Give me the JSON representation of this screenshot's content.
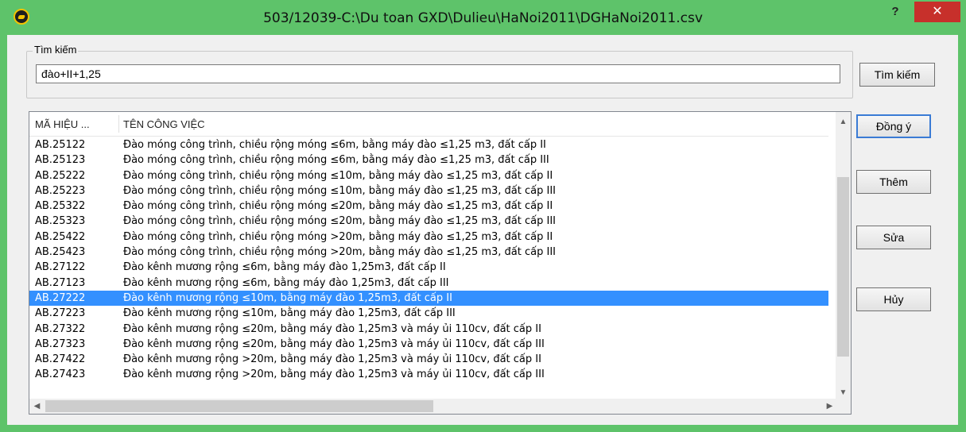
{
  "window": {
    "title": "503/12039-C:\\Du toan GXD\\Dulieu\\HaNoi2011\\DGHaNoi2011.csv",
    "help_label": "?",
    "close_label": "✕",
    "colors": {
      "titlebar": "#5ec36a",
      "close": "#c7302b",
      "selection": "#3390ff"
    }
  },
  "search": {
    "group_label": "Tìm kiếm",
    "value": "đào+II+1,25",
    "button_label": "Tìm kiếm"
  },
  "list": {
    "columns": [
      "MÃ HIỆU ...",
      "TÊN CÔNG VIỆC"
    ],
    "selected_index": 10,
    "rows": [
      {
        "code": "AB.25122",
        "name": "Đào móng công trình, chiều rộng móng ≤6m, bằng máy đào ≤1,25 m3, đất cấp II"
      },
      {
        "code": "AB.25123",
        "name": "Đào móng công trình, chiều rộng móng ≤6m, bằng máy đào ≤1,25 m3, đất cấp III"
      },
      {
        "code": "AB.25222",
        "name": "Đào móng công trình, chiều rộng móng ≤10m, bằng máy đào ≤1,25 m3, đất cấp II"
      },
      {
        "code": "AB.25223",
        "name": "Đào móng công trình, chiều rộng móng ≤10m, bằng máy đào ≤1,25 m3, đất cấp III"
      },
      {
        "code": "AB.25322",
        "name": "Đào móng công trình, chiều rộng móng ≤20m, bằng máy đào ≤1,25 m3, đất cấp II"
      },
      {
        "code": "AB.25323",
        "name": "Đào móng công trình, chiều rộng móng ≤20m, bằng máy đào ≤1,25 m3, đất cấp III"
      },
      {
        "code": "AB.25422",
        "name": "Đào móng công trình, chiều rộng móng >20m, bằng máy đào ≤1,25 m3, đất cấp II"
      },
      {
        "code": "AB.25423",
        "name": "Đào móng công trình, chiều rộng móng >20m, bằng máy đào ≤1,25 m3, đất cấp III"
      },
      {
        "code": "AB.27122",
        "name": "Đào kênh mương rộng ≤6m, bằng máy đào 1,25m3, đất cấp II"
      },
      {
        "code": "AB.27123",
        "name": "Đào kênh mương rộng ≤6m, bằng máy đào 1,25m3, đất cấp III"
      },
      {
        "code": "AB.27222",
        "name": "Đào kênh mương rộng ≤10m, bằng máy đào 1,25m3, đất cấp II"
      },
      {
        "code": "AB.27223",
        "name": "Đào kênh mương rộng ≤10m, bằng máy đào 1,25m3, đất cấp III"
      },
      {
        "code": "AB.27322",
        "name": "Đào kênh mương rộng ≤20m, bằng máy đào 1,25m3 và máy ủi 110cv, đất cấp II"
      },
      {
        "code": "AB.27323",
        "name": "Đào kênh mương rộng ≤20m, bằng máy đào 1,25m3 và máy ủi 110cv, đất cấp III"
      },
      {
        "code": "AB.27422",
        "name": "Đào kênh mương rộng >20m, bằng máy đào 1,25m3 và máy ủi 110cv, đất cấp II"
      },
      {
        "code": "AB.27423",
        "name": "Đào kênh mương rộng >20m, bằng máy đào 1,25m3 và máy ủi 110cv, đất cấp III"
      }
    ]
  },
  "actions": {
    "ok_label": "Đồng ý",
    "add_label": "Thêm",
    "edit_label": "Sửa",
    "cancel_label": "Hủy"
  },
  "scrollbar_icons": [
    "chevron-up-icon",
    "chevron-down-icon",
    "chevron-left-icon",
    "chevron-right-icon"
  ]
}
